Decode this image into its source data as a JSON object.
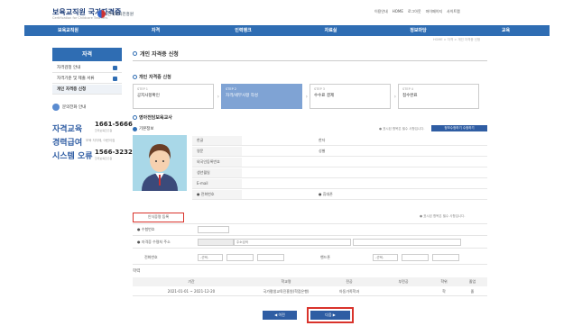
{
  "header": {
    "logo": "보육교직원 국가자격증",
    "logo_sub": "Certification for Childcare Teachers",
    "org": "한국보육진흥원",
    "util": [
      "이용안내",
      "HOME",
      "로그아웃",
      "마이페이지",
      "사이트맵"
    ]
  },
  "nav": [
    "보육교직원",
    "자격",
    "인력뱅크",
    "자료실",
    "정보마당",
    "교육"
  ],
  "breadcrumb": "HOME > 자격 > 개인 자격증 신청",
  "sidebar": {
    "title": "자격",
    "items": [
      "자격검정 안내",
      "자격기준 및 제출 서류",
      "개인 자격증 신청"
    ],
    "contact_heading": "문의전화 안내",
    "contacts": [
      {
        "label": "자격교육",
        "sub": "",
        "number": "1661-5666",
        "note": "한국보육진흥원"
      },
      {
        "label": "경력급여",
        "sub": "보육 지자체, 어린이집",
        "number": "",
        "note": ""
      },
      {
        "label": "시스템 오류",
        "sub": "",
        "number": "1566-3232",
        "note": "한국보육진흥원"
      }
    ]
  },
  "content": {
    "title": "개인 자격증 신청",
    "section1": "개인 자격증 신청",
    "steps": [
      {
        "no": "STEP 1",
        "label": "공지사항확인"
      },
      {
        "no": "STEP 2",
        "label": "자격/세부사항 작성"
      },
      {
        "no": "STEP 3",
        "label": "수수료 결제"
      },
      {
        "no": "STEP 4",
        "label": "접수완료"
      }
    ],
    "section2": "영아전담보육교사",
    "basic_info": "기본정보",
    "required_note": "● 표시된 항목은 필수 사항입니다.",
    "cert_button": "정보수정하기 수정하기",
    "fields_left": [
      "한글",
      "영문",
      "외국인등록번호",
      "생년월일",
      "E-mail",
      "● 전화번호"
    ],
    "fields_right": [
      "한자",
      "",
      "성별",
      "",
      "",
      "● 휴대폰"
    ],
    "id_photo_button": "인식증명 등록",
    "required_note2": "● 표시된 항목은 필수 사항입니다.",
    "exam_no_label": "● 수험번호",
    "address_label": "● 자격증 수령처 주소",
    "address_search": "주소검색",
    "phone_label": "전화번호",
    "mobile_label": "핸드폰",
    "select_default": "-선택-",
    "history_title": "학력",
    "table_headers": [
      "기간",
      "학교명",
      "전공",
      "부전공",
      "학위",
      "졸업"
    ],
    "table_row": [
      "2021-01-01 ~ 2021-12-20",
      "국가평생교육진흥원(학점은행)",
      "아동가족학과",
      "",
      "학",
      "졸"
    ],
    "prev": "◀ 이전",
    "next": "다음 ▶"
  },
  "colors": {
    "nav": "#2f6db3",
    "highlight": "#d9332b"
  }
}
